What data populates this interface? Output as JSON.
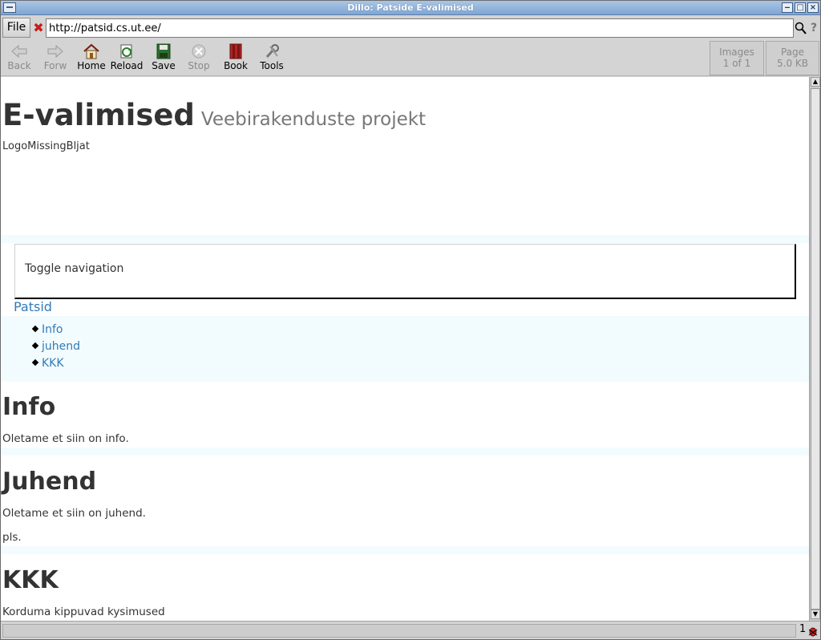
{
  "window": {
    "title": "Dillo: Patside E-valimised"
  },
  "locbar": {
    "file_label": "File",
    "url": "http://patsid.cs.ut.ee/"
  },
  "toolbar": {
    "back": "Back",
    "forward": "Forw",
    "home": "Home",
    "reload": "Reload",
    "save": "Save",
    "stop": "Stop",
    "book": "Book",
    "tools": "Tools",
    "images_label": "Images",
    "images_value": "1 of 1",
    "page_label": "Page",
    "page_value": "5.0 KB"
  },
  "content": {
    "title": "E-valimised",
    "subtitle": "Veebirakenduste projekt",
    "logo_alt": "LogoMissingBljat",
    "toggle_nav": "Toggle navigation",
    "brand": "Patsid",
    "nav": [
      "Info",
      "juhend",
      "KKK"
    ],
    "sections": [
      {
        "heading": "Info",
        "paragraphs": [
          "Oletame et siin on info."
        ]
      },
      {
        "heading": "Juhend",
        "paragraphs": [
          "Oletame et siin on juhend.",
          "pls."
        ]
      },
      {
        "heading": "KKK",
        "paragraphs": [
          "Korduma kippuvad kysimused"
        ]
      }
    ]
  },
  "statusbar": {
    "bug_count": "1"
  }
}
